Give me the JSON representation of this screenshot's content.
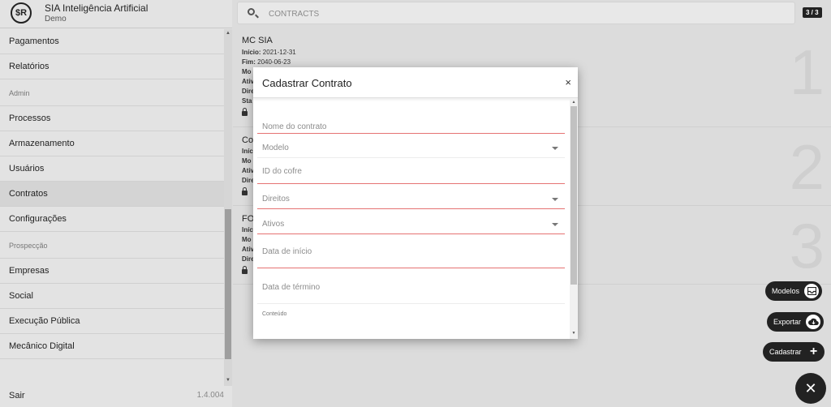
{
  "app": {
    "title": "SIA Inteligência Artificial",
    "subtitle": "Demo",
    "logo_text": "$R"
  },
  "sidebar": {
    "items": [
      {
        "type": "item",
        "label": "Pagamentos"
      },
      {
        "type": "item",
        "label": "Relatórios"
      },
      {
        "type": "section",
        "label": "Admin"
      },
      {
        "type": "item",
        "label": "Processos"
      },
      {
        "type": "item",
        "label": "Armazenamento"
      },
      {
        "type": "item",
        "label": "Usuários"
      },
      {
        "type": "item",
        "label": "Contratos",
        "active": true
      },
      {
        "type": "item",
        "label": "Configurações"
      },
      {
        "type": "section",
        "label": "Prospecção"
      },
      {
        "type": "item",
        "label": "Empresas"
      },
      {
        "type": "item",
        "label": "Social"
      },
      {
        "type": "item",
        "label": "Execução Pública"
      },
      {
        "type": "item",
        "label": "Mecânico Digital"
      }
    ],
    "logout_label": "Sair",
    "version": "1.4.004"
  },
  "search": {
    "placeholder": "CONTRACTS",
    "pager": "3 / 3"
  },
  "cards": [
    {
      "title": "MC SIA",
      "number": "1",
      "lines": [
        {
          "key": "Início:",
          "value": "2021-12-31"
        },
        {
          "key": "Fim:",
          "value": "2040-06-23"
        },
        {
          "key": "Mo",
          "value": ""
        },
        {
          "key": "Ativ",
          "value": ""
        },
        {
          "key": "Dire",
          "value": ""
        },
        {
          "key": "Sta",
          "value": ""
        }
      ]
    },
    {
      "title": "Co",
      "number": "2",
      "lines": [
        {
          "key": "Iníc",
          "value": ""
        },
        {
          "key": "Mo",
          "value": ""
        },
        {
          "key": "Ativ",
          "value": ""
        },
        {
          "key": "Dire",
          "value": ""
        }
      ]
    },
    {
      "title": "FO",
      "number": "3",
      "lines": [
        {
          "key": "Iníc",
          "value": ""
        },
        {
          "key": "Mo",
          "value": ""
        },
        {
          "key": "Ativ",
          "value": ""
        },
        {
          "key": "Dire",
          "value": ""
        }
      ]
    }
  ],
  "fabs": {
    "modelos": {
      "label": "Modelos",
      "icon": "inbox-icon"
    },
    "exportar": {
      "label": "Exportar",
      "icon": "cloud-download-icon"
    },
    "cadastrar": {
      "label": "Cadastrar",
      "icon": "plus-icon",
      "glyph": "+"
    },
    "close": {
      "icon": "close-icon",
      "glyph": "✕"
    }
  },
  "modal": {
    "title": "Cadastrar Contrato",
    "close_glyph": "×",
    "fields": {
      "nome": {
        "label": "Nome do contrato"
      },
      "modelo": {
        "label": "Modelo"
      },
      "cofre": {
        "label": "ID do cofre"
      },
      "direitos": {
        "label": "Direitos"
      },
      "ativos": {
        "label": "Ativos"
      },
      "inicio": {
        "label": "Data de início"
      },
      "termino": {
        "label": "Data de término"
      },
      "conteudo": {
        "label": "Conteúdo"
      }
    }
  },
  "colors": {
    "accent_error": "#e57373",
    "dark": "#222222"
  }
}
